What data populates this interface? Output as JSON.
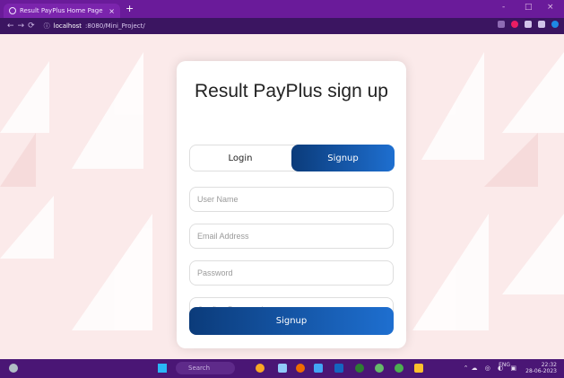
{
  "browser": {
    "tab_title": "Result PayPlus Home Page",
    "tab_close": "×",
    "new_tab": "+",
    "address_host": "localhost",
    "address_path": ":8080/Mini_Project/",
    "window_controls": [
      "-",
      "□",
      "×"
    ]
  },
  "form": {
    "title": "Result PayPlus sign up",
    "login_tab": "Login",
    "signup_tab": "Signup",
    "fields": {
      "username_placeholder": "User Name",
      "email_placeholder": "Email Address",
      "password_placeholder": "Password",
      "confirm_placeholder": "Confirm Password"
    },
    "submit_label": "Signup"
  },
  "taskbar": {
    "search_label": "Search",
    "lang": "ENG",
    "time": "22:32",
    "date": "28-06-2023"
  },
  "colors": {
    "chrome_purple": "#6a1b9a",
    "button_gradient_start": "#0b3b7a",
    "button_gradient_end": "#1e6fd0",
    "background_pink": "#fbeaea"
  }
}
